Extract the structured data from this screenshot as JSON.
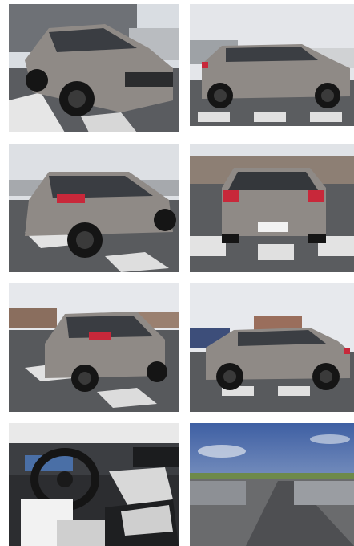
{
  "gallery": {
    "photos": [
      {
        "view": "front-three-quarter"
      },
      {
        "view": "side-profile-right"
      },
      {
        "view": "rear-three-quarter-left"
      },
      {
        "view": "rear"
      },
      {
        "view": "rear-three-quarter-left-wide"
      },
      {
        "view": "side-profile-left"
      },
      {
        "view": "interior-dashboard"
      },
      {
        "view": "parking-lot-blurred"
      }
    ]
  },
  "colors": {
    "car_body": "#8f8a86",
    "sky": "#e8eaee",
    "asphalt": "#55575a",
    "wheel": "#151515",
    "taillight": "#c8283a"
  }
}
